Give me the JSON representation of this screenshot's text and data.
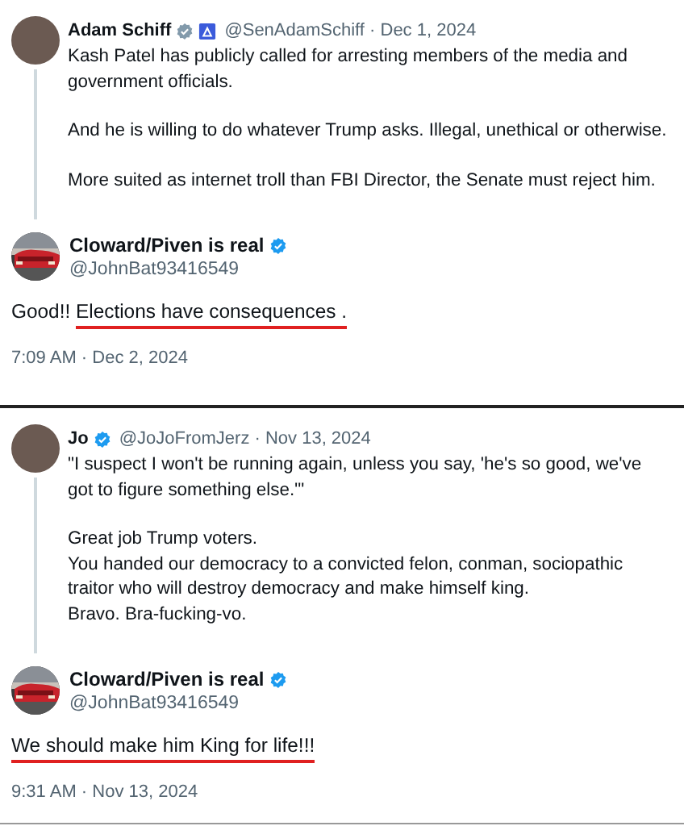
{
  "panels": [
    {
      "original": {
        "name": "Adam Schiff",
        "badges": [
          {
            "kind": "verified",
            "color": "#829aab"
          },
          {
            "kind": "affiliate",
            "color": "#3b5bdb"
          }
        ],
        "meta": "@SenAdamSchiff · Dec 1, 2024",
        "paragraphs": [
          [
            "Kash Patel has publicly called for arresting members of the media and government officials."
          ],
          [
            "And he is willing to do whatever Trump asks. Illegal, unethical or otherwise."
          ],
          [
            "More suited as internet troll than FBI Director, the Senate must reject him."
          ]
        ]
      },
      "reply": {
        "name": "Cloward/Piven is real",
        "badges": [
          {
            "kind": "verified",
            "color": "#1d9bf0"
          }
        ],
        "handle": "@JohnBat93416549",
        "text": [
          {
            "text": "Good!! ",
            "underlined": false
          },
          {
            "text": "Elections have consequences .",
            "underlined": true
          }
        ],
        "time": "7:09 AM · Dec 2, 2024"
      }
    },
    {
      "original": {
        "name": "Jo",
        "badges": [
          {
            "kind": "verified",
            "color": "#1d9bf0"
          }
        ],
        "meta": "@JoJoFromJerz · Nov 13, 2024",
        "paragraphs": [
          [
            "\"I suspect I won't be running again, unless you say, 'he's so good, we've got to figure something else.'\""
          ],
          [
            "Great job Trump voters.",
            "You handed our democracy to a convicted felon, conman, sociopathic traitor who will destroy democracy and make himself king.",
            "Bravo. Bra-fucking-vo."
          ]
        ]
      },
      "reply": {
        "name": "Cloward/Piven is real",
        "badges": [
          {
            "kind": "verified",
            "color": "#1d9bf0"
          }
        ],
        "handle": "@JohnBat93416549",
        "text": [
          {
            "text": "We should make him King for life!!!",
            "underlined": true
          }
        ],
        "time": "9:31 AM · Nov 13, 2024"
      }
    }
  ]
}
